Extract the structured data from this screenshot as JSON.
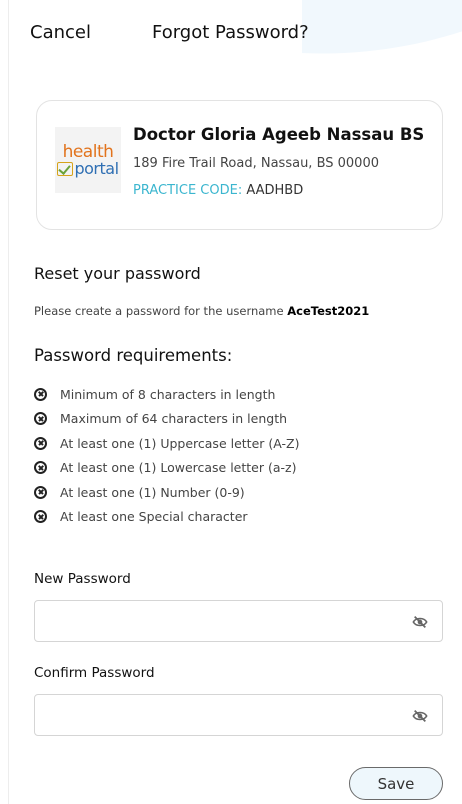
{
  "header": {
    "cancel_label": "Cancel",
    "title": "Forgot Password?"
  },
  "practice": {
    "logo_text_top": "health",
    "logo_text_bottom": "portal",
    "doctor_name": "Doctor Gloria Ageeb Nassau BS",
    "address": "189 Fire Trail Road, Nassau, BS 00000",
    "code_label": "PRACTICE CODE:",
    "code_value": "AADHBD"
  },
  "reset": {
    "title": "Reset your password",
    "instruction_prefix": "Please create a password for the username",
    "username": "AceTest2021"
  },
  "requirements": {
    "title": "Password requirements:",
    "items": [
      "Minimum of 8 characters in length",
      "Maximum of 64 characters in length",
      "At least one (1) Uppercase letter (A-Z)",
      "At least one (1) Lowercase letter (a-z)",
      "At least one (1) Number (0-9)",
      "At least one Special character"
    ]
  },
  "fields": {
    "new_label": "New Password",
    "new_value": "",
    "confirm_label": "Confirm Password",
    "confirm_value": ""
  },
  "actions": {
    "save_label": "Save"
  },
  "colors": {
    "accent": "#3bb6cf",
    "save_bg": "#eef7fc"
  },
  "icons": {
    "requirement": "x-circle-icon",
    "password_toggle": "eye-slash-icon"
  }
}
